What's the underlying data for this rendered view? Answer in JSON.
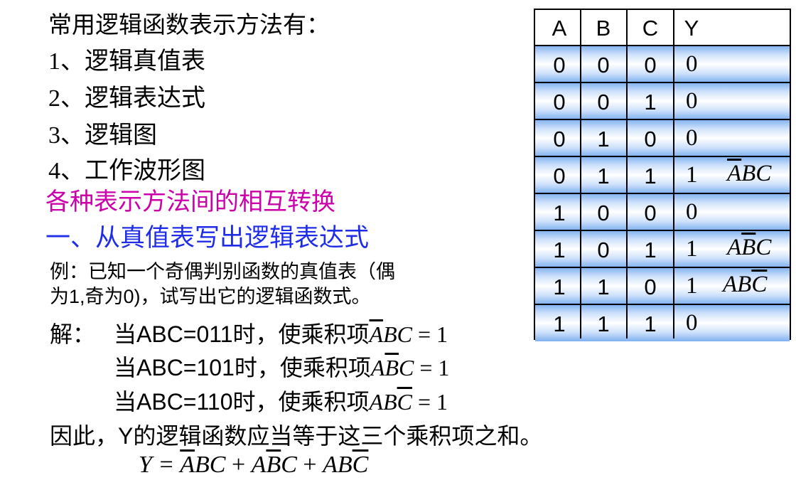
{
  "title": "常用逻辑函数表示方法有：",
  "methods": [
    "1、逻辑真值表",
    "2、逻辑表达式",
    "3、逻辑图",
    "4、工作波形图"
  ],
  "section_pink": "各种表示方法间的相互转换",
  "section_blue": "一、从真值表写出逻辑表达式",
  "example_line1": "例：已知一个奇偶判别函数的真值表（偶",
  "example_line2": "为1,奇为0)，试写出它的逻辑函数式。",
  "solution": {
    "label": "解：",
    "lines": [
      {
        "cond": "当ABC=011时，使乘积项",
        "term_ov": "A",
        "term_rest": "BC",
        "eq": " = 1"
      },
      {
        "cond": "当ABC=101时，使乘积项",
        "term_pre": "A",
        "term_ov": "B",
        "term_rest": "C",
        "eq": " = 1"
      },
      {
        "cond": "当ABC=110时，使乘积项",
        "term_pre": "AB",
        "term_ov": "C",
        "eq": " = 1"
      }
    ],
    "conclusion": "因此，Y的逻辑函数应当等于这三个乘积项之和。",
    "formula": {
      "lhs": "Y = ",
      "plus": " + "
    }
  },
  "truth_table": {
    "headers": [
      "A",
      "B",
      "C",
      "Y"
    ],
    "rows": [
      [
        "0",
        "0",
        "0",
        "0"
      ],
      [
        "0",
        "0",
        "1",
        "0"
      ],
      [
        "0",
        "1",
        "0",
        "0"
      ],
      [
        "0",
        "1",
        "1",
        "1"
      ],
      [
        "1",
        "0",
        "0",
        "0"
      ],
      [
        "1",
        "0",
        "1",
        "1"
      ],
      [
        "1",
        "1",
        "0",
        "1"
      ],
      [
        "1",
        "1",
        "1",
        "0"
      ]
    ]
  }
}
